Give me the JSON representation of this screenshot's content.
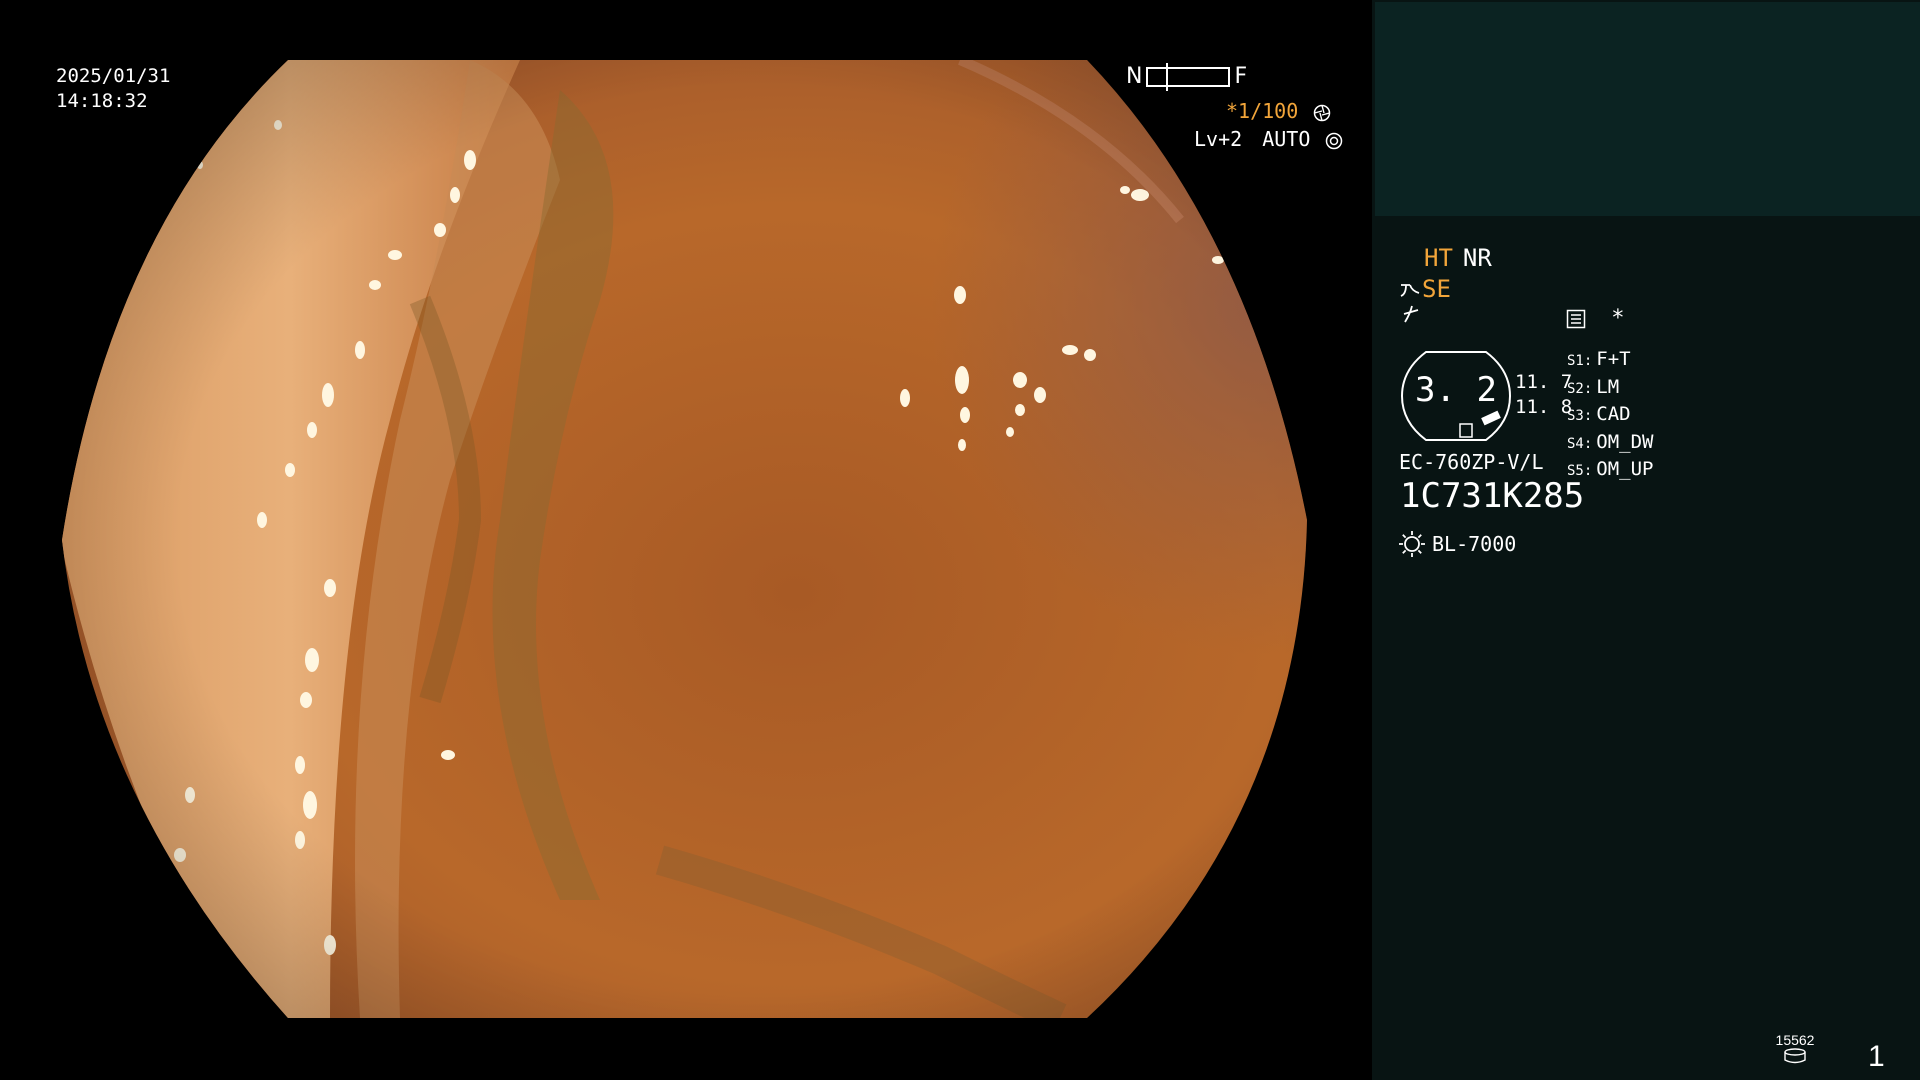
{
  "overlay": {
    "date": "2025/01/31",
    "time": "14:18:32",
    "nf_left": "N",
    "nf_right": "F",
    "zoom_ratio": "*1/100",
    "level_label": "Lv+2",
    "auto_label": "AUTO"
  },
  "panel": {
    "ht_label": "HT",
    "nr_label": "NR",
    "se_label": "SE",
    "asterisk": "*",
    "badge_value": "3. 2",
    "stat_1": "11. 7",
    "stat_2": "11. 8",
    "settings": [
      {
        "key": "S1:",
        "value": "F+T"
      },
      {
        "key": "S2:",
        "value": "LM"
      },
      {
        "key": "S3:",
        "value": "CAD"
      },
      {
        "key": "S4:",
        "value": "OM_DW"
      },
      {
        "key": "S5:",
        "value": "OM_UP"
      }
    ],
    "scope_model": "EC-760ZP-V/L",
    "serial_number": "1C731K285",
    "light_source": "BL-7000",
    "counter": "15562",
    "page_number": "1"
  },
  "colors": {
    "accent_orange": "#f2a53a",
    "panel_bg": "#081413",
    "thumb_bg": "#0b2322",
    "tissue_base": "#b8682a"
  },
  "icons": {
    "shutter": "aperture-icon",
    "auto": "auto-gear-icon",
    "structure_enhance": "structure-enhance-icon",
    "edge_enhance": "edge-enhance-icon",
    "menu": "menu-list-icon",
    "light": "sun-light-icon",
    "disk": "storage-disk-icon"
  }
}
